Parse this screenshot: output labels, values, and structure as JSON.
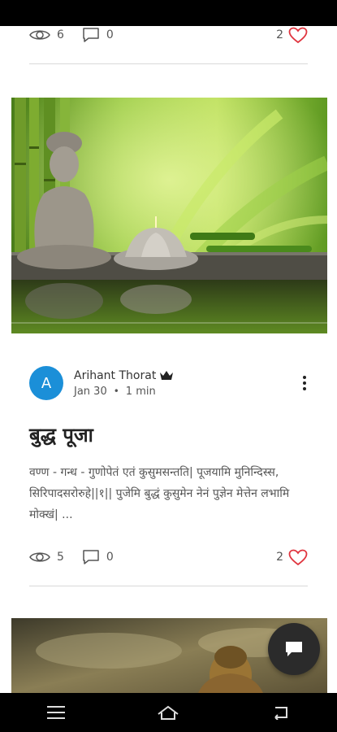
{
  "top_post": {
    "views": "6",
    "comments": "0",
    "likes": "2"
  },
  "post": {
    "author": "Arihant Thorat",
    "avatar_letter": "A",
    "date": "Jan 30",
    "read_time": "1 min",
    "title": "बुद्ध पूजा",
    "excerpt": "वण्ण - गन्ध - गुणोपेतं एतं कुसुमसन्तति| पूजयामि मुनिन्दिस्स, सिरिपादसरोरुहे||१|| पुजेमि बुद्धं कुसुमेन नेनं पुज्ञेन मेत्तेन लभामि मोक्खं| ...",
    "views": "5",
    "comments": "0",
    "likes": "2"
  },
  "colors": {
    "accent_blue": "#1b8fd8",
    "heart_red": "#e0353f",
    "fab": "#2b2b2b"
  },
  "icons": [
    "eye-icon",
    "comment-icon",
    "heart-icon",
    "crown-icon",
    "more-vertical-icon",
    "chat-icon",
    "menu-icon",
    "home-icon",
    "back-icon"
  ]
}
